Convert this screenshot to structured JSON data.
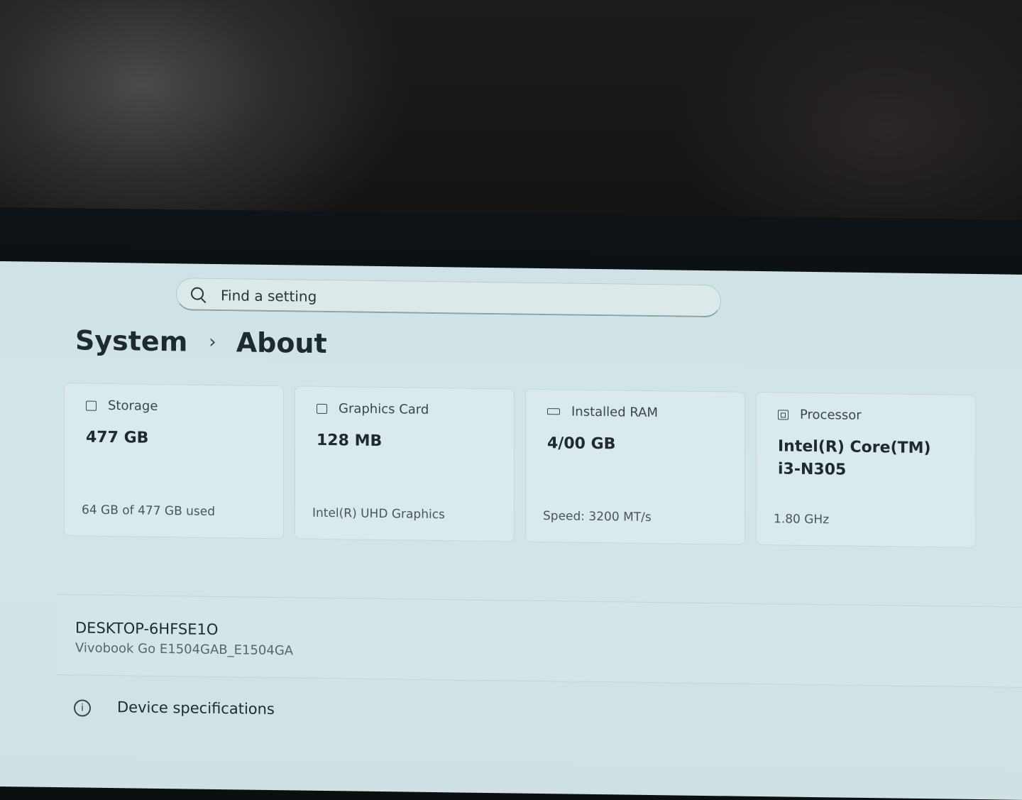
{
  "search": {
    "placeholder": "Find a setting"
  },
  "breadcrumb": {
    "parent": "System",
    "current": "About"
  },
  "cards": [
    {
      "label": "Storage",
      "value": "477 GB",
      "sub": "64 GB of 477 GB used",
      "icon": "storage-icon"
    },
    {
      "label": "Graphics Card",
      "value": "128 MB",
      "sub": "Intel(R) UHD Graphics",
      "icon": "graphics-card-icon"
    },
    {
      "label": "Installed RAM",
      "value": "4/00 GB",
      "sub": "Speed: 3200 MT/s",
      "icon": "ram-icon"
    },
    {
      "label": "Processor",
      "value": "Intel(R) Core(TM) i3-N305",
      "sub": "1.80 GHz",
      "icon": "processor-icon"
    }
  ],
  "device": {
    "name": "DESKTOP-6HFSE1O",
    "model": "Vivobook Go E1504GAB_E1504GA"
  },
  "specs": {
    "label": "Device specifications",
    "icon": "info-icon"
  },
  "colors": {
    "screen_bg": "#d3e5e8",
    "card_bg": "#dae9ec",
    "text": "#1f2a2e"
  }
}
